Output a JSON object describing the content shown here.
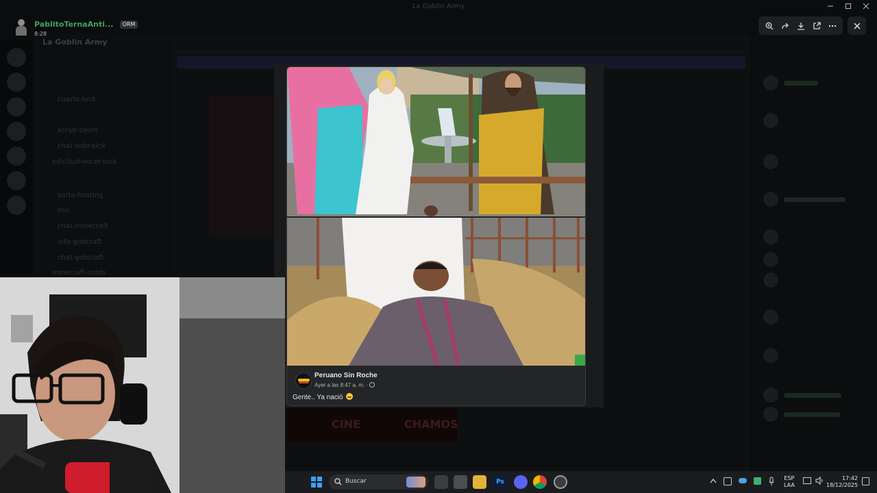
{
  "window": {
    "title": "La Goblin Army"
  },
  "viewer": {
    "uploader_name": "PablitoTernaAnti...",
    "uploader_tag": "ORM",
    "uploader_time": "8:28",
    "tools": [
      "zoom-in-icon",
      "forward-icon",
      "download-icon",
      "open-external-icon",
      "more-icon"
    ],
    "close_icon": "close-icon"
  },
  "background": {
    "guild_name": "La Goblin Army",
    "channels": [
      "cuarto-luck",
      "script-zoom",
      "chat-sobr-kick",
      "edicitud-vocer-luck",
      "sorto-hosting",
      "mic",
      "chat-minecraft",
      "info-gobcraft",
      "chat-gobcraft",
      "minecraft-cords"
    ]
  },
  "post": {
    "page_name": "Peruano Sin Roche",
    "date": "Ayer a las 8:47 a. m. ·",
    "caption": "Gente.. Ya nació"
  },
  "taskbar": {
    "search_placeholder": "Buscar",
    "lang_top": "ESP",
    "lang_bottom": "LAA",
    "time": "17:42",
    "date": "18/12/2025",
    "accent": "#3aa0ff"
  }
}
